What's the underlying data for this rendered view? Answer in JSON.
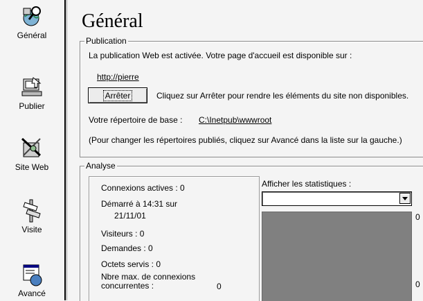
{
  "nav": {
    "items": [
      {
        "label": "Général",
        "icon": "search-globe-icon"
      },
      {
        "label": "Publier",
        "icon": "publish-computer-icon"
      },
      {
        "label": "Site Web",
        "icon": "website-tools-icon"
      },
      {
        "label": "Visite",
        "icon": "signpost-icon"
      },
      {
        "label": "Avancé",
        "icon": "advanced-window-icon"
      }
    ]
  },
  "page": {
    "title": "Général"
  },
  "publication": {
    "legend": "Publication",
    "status_text": "La publication Web est activée. Votre page d'accueil est disponible sur :",
    "home_url": "http://pierre",
    "stop_button": "Arrêter",
    "stop_hint": "Cliquez sur Arrêter pour rendre les éléments du site non disponibles.",
    "base_dir_label": "Votre répertoire de base :",
    "base_dir": "C:\\Inetpub\\wwwroot",
    "advanced_hint": "(Pour changer les répertoires publiés, cliquez sur Avancé dans la liste sur la gauche.)"
  },
  "analysis": {
    "legend": "Analyse",
    "active_connections": "Connexions actives : 0",
    "started_line1": "Démarré à 14:31 sur",
    "started_line2": "21/11/01",
    "visitors": "Visiteurs : 0",
    "requests": "Demandes : 0",
    "bytes_served": "Octets servis : 0",
    "max_conn_line1": "Nbre max. de connexions",
    "max_conn_line2": "concurrentes :",
    "max_conn_value": "0",
    "stats_label": "Afficher les statistiques :",
    "stats_selected": "",
    "chart_top_value": "0",
    "chart_bottom_value": "0",
    "chart_color": "#808080"
  }
}
